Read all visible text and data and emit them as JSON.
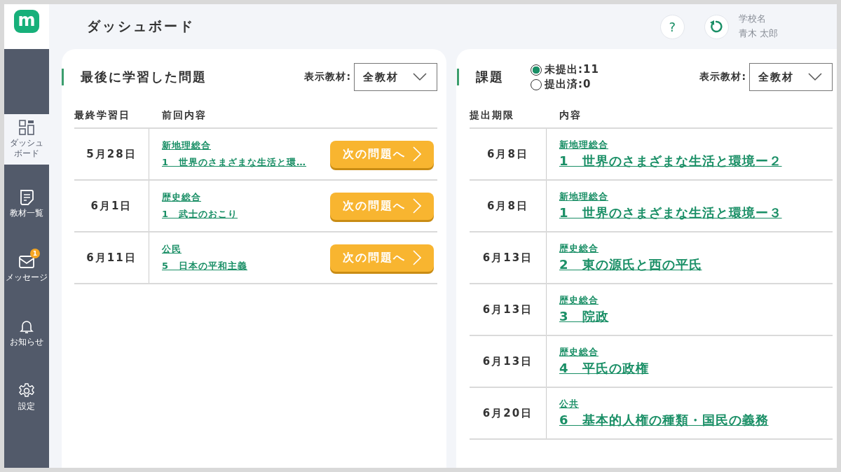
{
  "logo": "m",
  "sidebar": {
    "items": [
      {
        "label": "ダッシュボード",
        "selected": true
      },
      {
        "label": "教材一覧",
        "selected": false
      },
      {
        "label": "メッセージ",
        "selected": false,
        "badge": "1"
      },
      {
        "label": "お知らせ",
        "selected": false
      },
      {
        "label": "設定",
        "selected": false
      }
    ]
  },
  "header": {
    "title": "ダッシュボード",
    "help": "?",
    "school": "学校名",
    "user": "青木 太郎"
  },
  "recent": {
    "title": "最後に学習した問題",
    "filter": {
      "label": "表示教材:",
      "value": "全教材"
    },
    "columns": [
      "最終学習日",
      "前回内容"
    ],
    "rows": [
      {
        "date": "5月28日",
        "subject": "新地理総合",
        "topic": "1　世界のさまざまな生活と環…",
        "button": "次の問題へ"
      },
      {
        "date": "6月1日",
        "subject": "歴史総合",
        "topic": "1　武士のおこり",
        "button": "次の問題へ"
      },
      {
        "date": "6月11日",
        "subject": "公民",
        "topic": "5　日本の平和主義",
        "button": "次の問題へ"
      }
    ]
  },
  "tasks": {
    "title": "課題",
    "radios": [
      {
        "label": "未提出:11",
        "selected": true
      },
      {
        "label": "提出済:0",
        "selected": false
      }
    ],
    "filter": {
      "label": "表示教材:",
      "value": "全教材"
    },
    "columns": [
      "提出期限",
      "内容"
    ],
    "rows": [
      {
        "date": "6月8日",
        "subject": "新地理総合",
        "topic": "1　世界のさまざまな生活と環境ー２"
      },
      {
        "date": "6月8日",
        "subject": "新地理総合",
        "topic": "1　世界のさまざまな生活と環境ー３"
      },
      {
        "date": "6月13日",
        "subject": "歴史総合",
        "topic": "2　東の源氏と西の平氏"
      },
      {
        "date": "6月13日",
        "subject": "歴史総合",
        "topic": "3　院政"
      },
      {
        "date": "6月13日",
        "subject": "歴史総合",
        "topic": "4　平氏の政権"
      },
      {
        "date": "6月20日",
        "subject": "公共",
        "topic": "6　基本的人権の種類・国民の義務"
      }
    ]
  }
}
